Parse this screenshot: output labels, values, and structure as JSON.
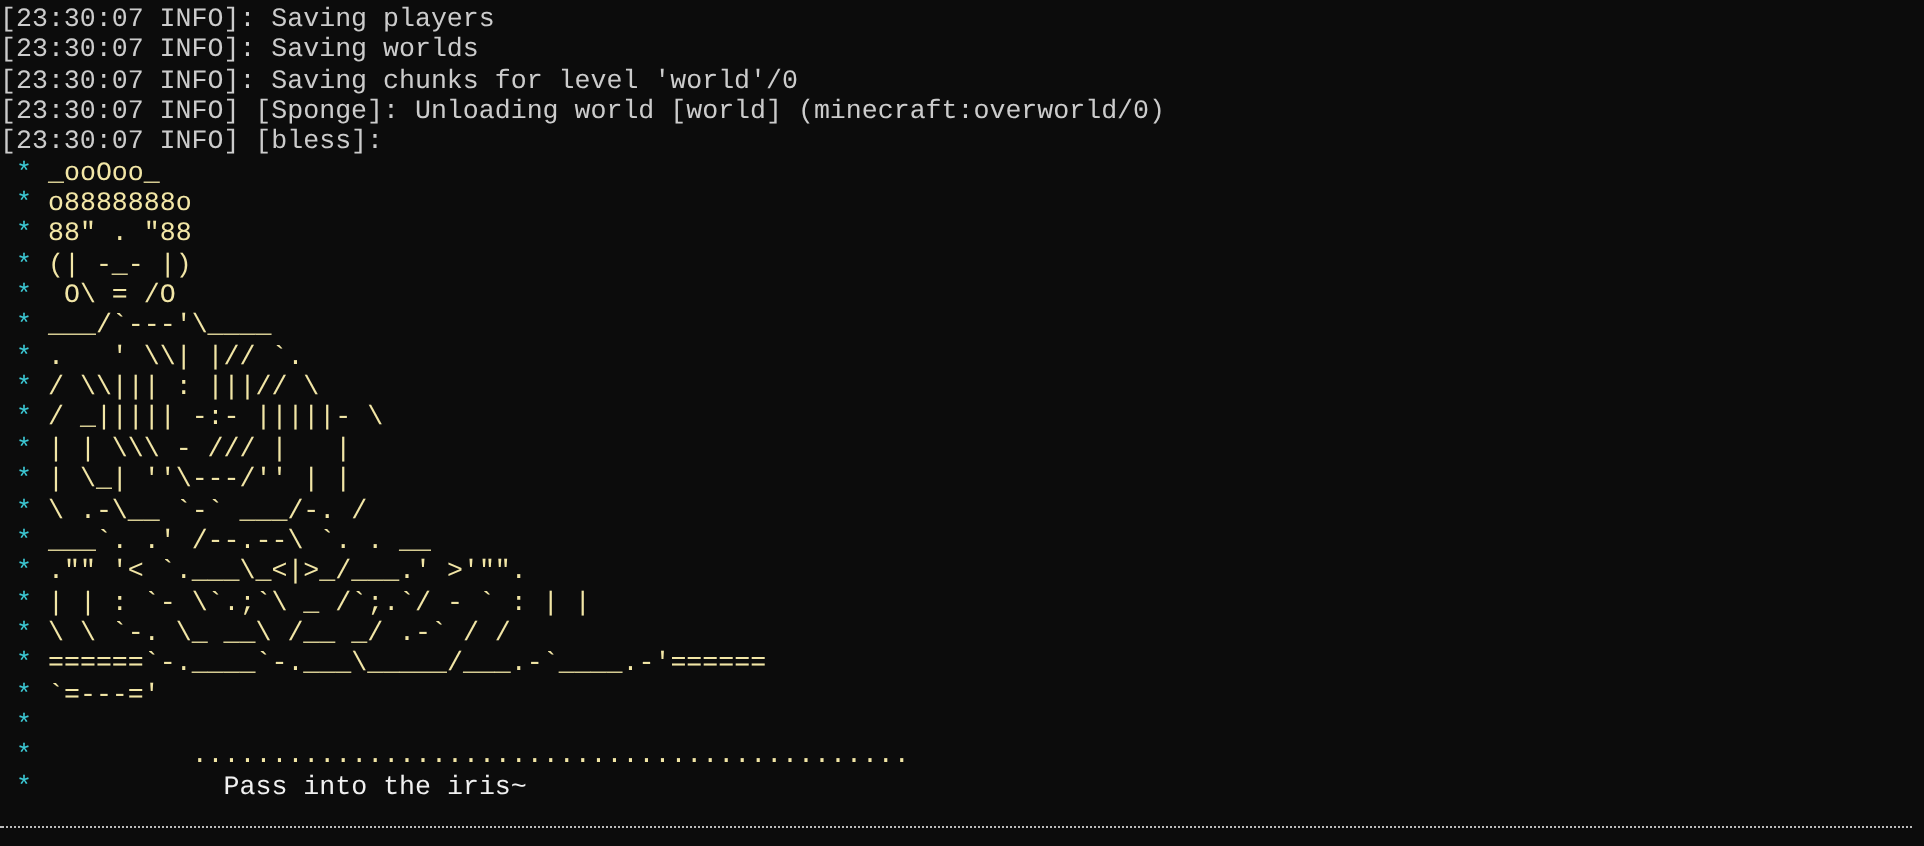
{
  "log_lines": [
    {
      "text": "[23:30:07 INFO]: Saving players"
    },
    {
      "text": "[23:30:07 INFO]: Saving worlds"
    },
    {
      "text": "[23:30:07 INFO]: Saving chunks for level 'world'/0"
    },
    {
      "text": "[23:30:07 INFO] [Sponge]: Unloading world [world] (minecraft:overworld/0)"
    },
    {
      "text": "[23:30:07 INFO] [bless]:"
    }
  ],
  "banner_lines": [
    {
      "marker": "*",
      "kind": "art",
      "text": "_ooOoo_"
    },
    {
      "marker": "*",
      "kind": "art",
      "text": "o8888888o"
    },
    {
      "marker": "*",
      "kind": "art",
      "text": "88\" . \"88"
    },
    {
      "marker": "*",
      "kind": "art",
      "text": "(| -_- |)"
    },
    {
      "marker": "*",
      "kind": "art",
      "text": " O\\ = /O"
    },
    {
      "marker": "*",
      "kind": "art",
      "text": "___/`---'\\____"
    },
    {
      "marker": "*",
      "kind": "art",
      "text": ".   ' \\\\| |// `."
    },
    {
      "marker": "*",
      "kind": "art",
      "text": "/ \\\\||| : |||// \\"
    },
    {
      "marker": "*",
      "kind": "art",
      "text": "/ _||||| -:- |||||- \\"
    },
    {
      "marker": "*",
      "kind": "art",
      "text": "| | \\\\\\ - /// |   |"
    },
    {
      "marker": "*",
      "kind": "art",
      "text": "| \\_| ''\\---/'' | |"
    },
    {
      "marker": "*",
      "kind": "art",
      "text": "\\ .-\\__ `-` ___/-. /"
    },
    {
      "marker": "*",
      "kind": "art",
      "text": "___`. .' /--.--\\ `. . __"
    },
    {
      "marker": "*",
      "kind": "art",
      "text": ".\"\" '< `.___\\_<|>_/___.' >'\"\"."
    },
    {
      "marker": "*",
      "kind": "art",
      "text": "| | : `- \\`.;`\\ _ /`;.`/ - ` : | |"
    },
    {
      "marker": "*",
      "kind": "art",
      "text": "\\ \\ `-. \\_ __\\ /__ _/ .-` / /"
    },
    {
      "marker": "*",
      "kind": "art",
      "text": "======`-.____`-.___\\_____/___.-`____.-'======"
    },
    {
      "marker": "*",
      "kind": "art",
      "text": "`=---='"
    },
    {
      "marker": "*"
    },
    {
      "marker": "*",
      "kind": "art",
      "text": "         ............................................."
    },
    {
      "marker": "*",
      "kind": "caption",
      "text": "           Pass into the iris~"
    }
  ]
}
